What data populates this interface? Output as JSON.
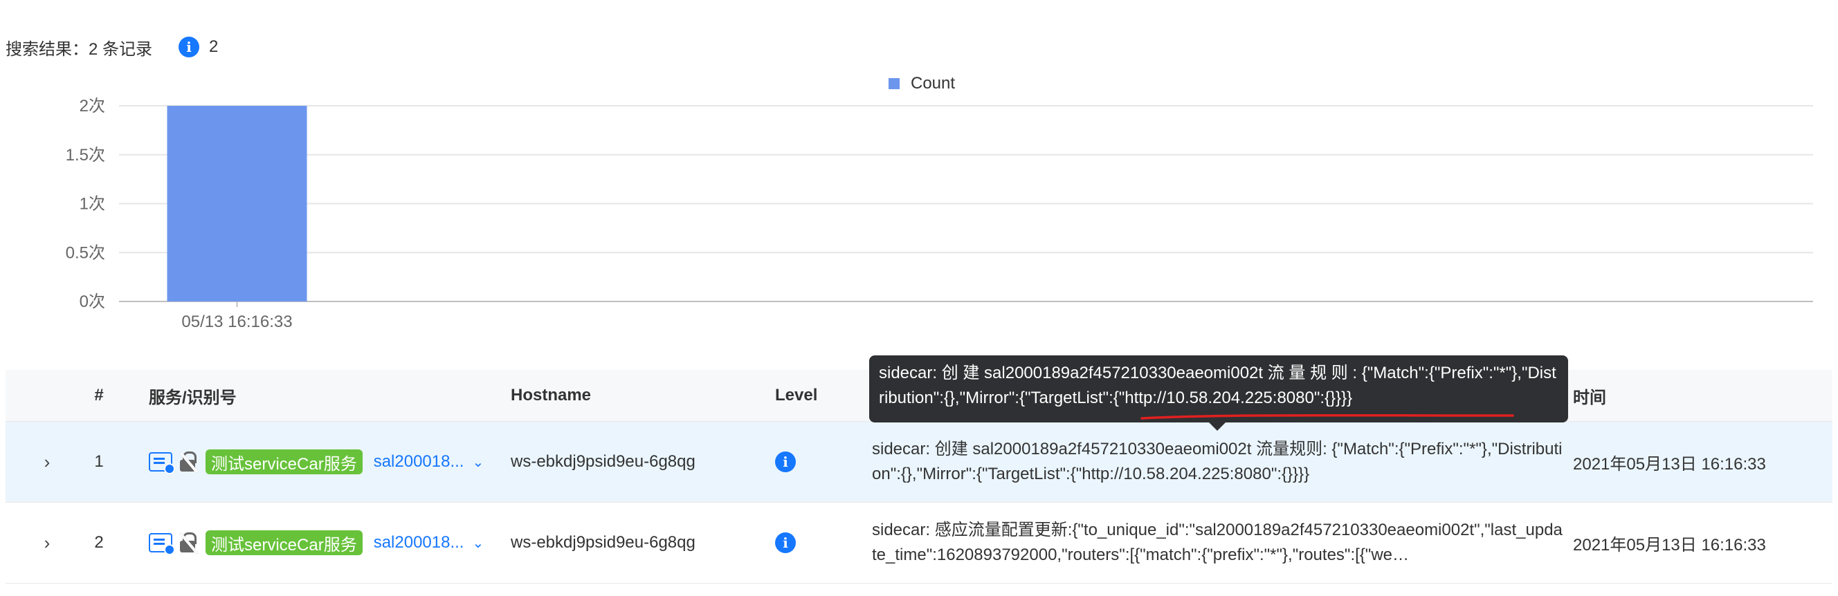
{
  "summary": {
    "label": "搜索结果：2 条记录",
    "info_icon": "i",
    "info_count": "2"
  },
  "chart_data": {
    "type": "bar",
    "categories": [
      "05/13 16:16:33"
    ],
    "series": [
      {
        "name": "Count",
        "values": [
          2
        ]
      }
    ],
    "ylim": [
      0,
      2
    ],
    "yticks": [
      "0次",
      "0.5次",
      "1次",
      "1.5次",
      "2次"
    ],
    "grid": true,
    "legend_position": "top-center",
    "bar_color": "#6c96ee"
  },
  "table": {
    "headers": {
      "num": "#",
      "service": "服务/识别号",
      "hostname": "Hostname",
      "level": "Level",
      "time": "时间"
    },
    "rows": [
      {
        "num": "1",
        "tag": "测试serviceCar服务",
        "service_id": "sal200018...",
        "hostname": "ws-ebkdj9psid9eu-6g8qg",
        "level_icon": "i",
        "message": "sidecar: 创建 sal2000189a2f457210330eaeomi002t 流量规则: {\"Match\":{\"Prefix\":\"*\"},\"Distribution\":{},\"Mirror\":{\"TargetList\":{\"http://10.58.204.225:8080\":{}}}}",
        "time": "2021年05月13日 16:16:33"
      },
      {
        "num": "2",
        "tag": "测试serviceCar服务",
        "service_id": "sal200018...",
        "hostname": "ws-ebkdj9psid9eu-6g8qg",
        "level_icon": "i",
        "message": "sidecar: 感应流量配置更新:{\"to_unique_id\":\"sal2000189a2f457210330eaeomi002t\",\"last_update_time\":1620893792000,\"routers\":[{\"match\":{\"prefix\":\"*\"},\"routes\":[{\"we…",
        "time": "2021年05月13日 16:16:33"
      }
    ]
  },
  "tooltip": {
    "text": "sidecar: 创 建  sal2000189a2f457210330eaeomi002t  流 量 规 则 : {\"Match\":{\"Prefix\":\"*\"},\"Distribution\":{},\"Mirror\":{\"TargetList\":{\"http://10.58.204.225:8080\":{}}}}"
  },
  "colors": {
    "accent": "#1677ff",
    "tag_green": "#67c23a",
    "selected_row": "#eaf5fd",
    "tooltip_bg": "#2f3033",
    "annotation_red": "#e02020"
  }
}
